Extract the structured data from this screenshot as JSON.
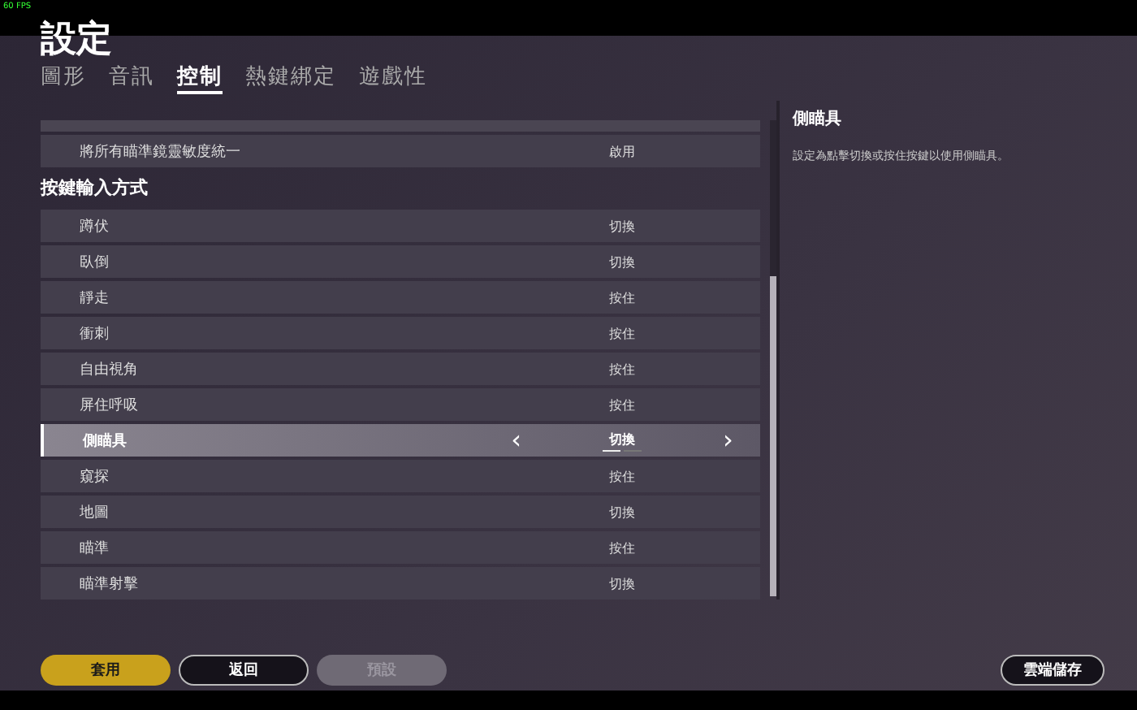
{
  "fps": "60 FPS",
  "title": "設定",
  "tabs": [
    {
      "label": "圖形",
      "selected": false
    },
    {
      "label": "音訊",
      "selected": false
    },
    {
      "label": "控制",
      "selected": true
    },
    {
      "label": "熱鍵綁定",
      "selected": false
    },
    {
      "label": "遊戲性",
      "selected": false
    }
  ],
  "sections": [
    {
      "kind": "rows",
      "rows": [
        {
          "label": "將所有瞄準鏡靈敏度統一",
          "value": "啟用",
          "selected": false
        }
      ]
    },
    {
      "kind": "header",
      "title": "按鍵輸入方式",
      "rows": [
        {
          "label": "蹲伏",
          "value": "切換",
          "selected": false
        },
        {
          "label": "臥倒",
          "value": "切換",
          "selected": false
        },
        {
          "label": "靜走",
          "value": "按住",
          "selected": false
        },
        {
          "label": "衝刺",
          "value": "按住",
          "selected": false
        },
        {
          "label": "自由視角",
          "value": "按住",
          "selected": false
        },
        {
          "label": "屏住呼吸",
          "value": "按住",
          "selected": false
        },
        {
          "label": "側瞄具",
          "value": "切換",
          "selected": true,
          "prev": "‹",
          "next": "›",
          "pager": [
            {
              "selected": true
            },
            {
              "selected": false
            }
          ]
        },
        {
          "label": "窺探",
          "value": "按住",
          "selected": false
        },
        {
          "label": "地圖",
          "value": "切換",
          "selected": false
        },
        {
          "label": "瞄準",
          "value": "按住",
          "selected": false
        },
        {
          "label": "瞄準射擊",
          "value": "切換",
          "selected": false
        }
      ]
    }
  ],
  "detail": {
    "title": "側瞄具",
    "text": "設定為點擊切換或按住按鍵以使用側瞄具。"
  },
  "buttons": [
    {
      "label": "套用",
      "kind": "primary"
    },
    {
      "label": "返回",
      "kind": "outline"
    },
    {
      "label": "預設",
      "kind": "disabled"
    }
  ],
  "cloud_button": {
    "label": "雲端儲存"
  }
}
